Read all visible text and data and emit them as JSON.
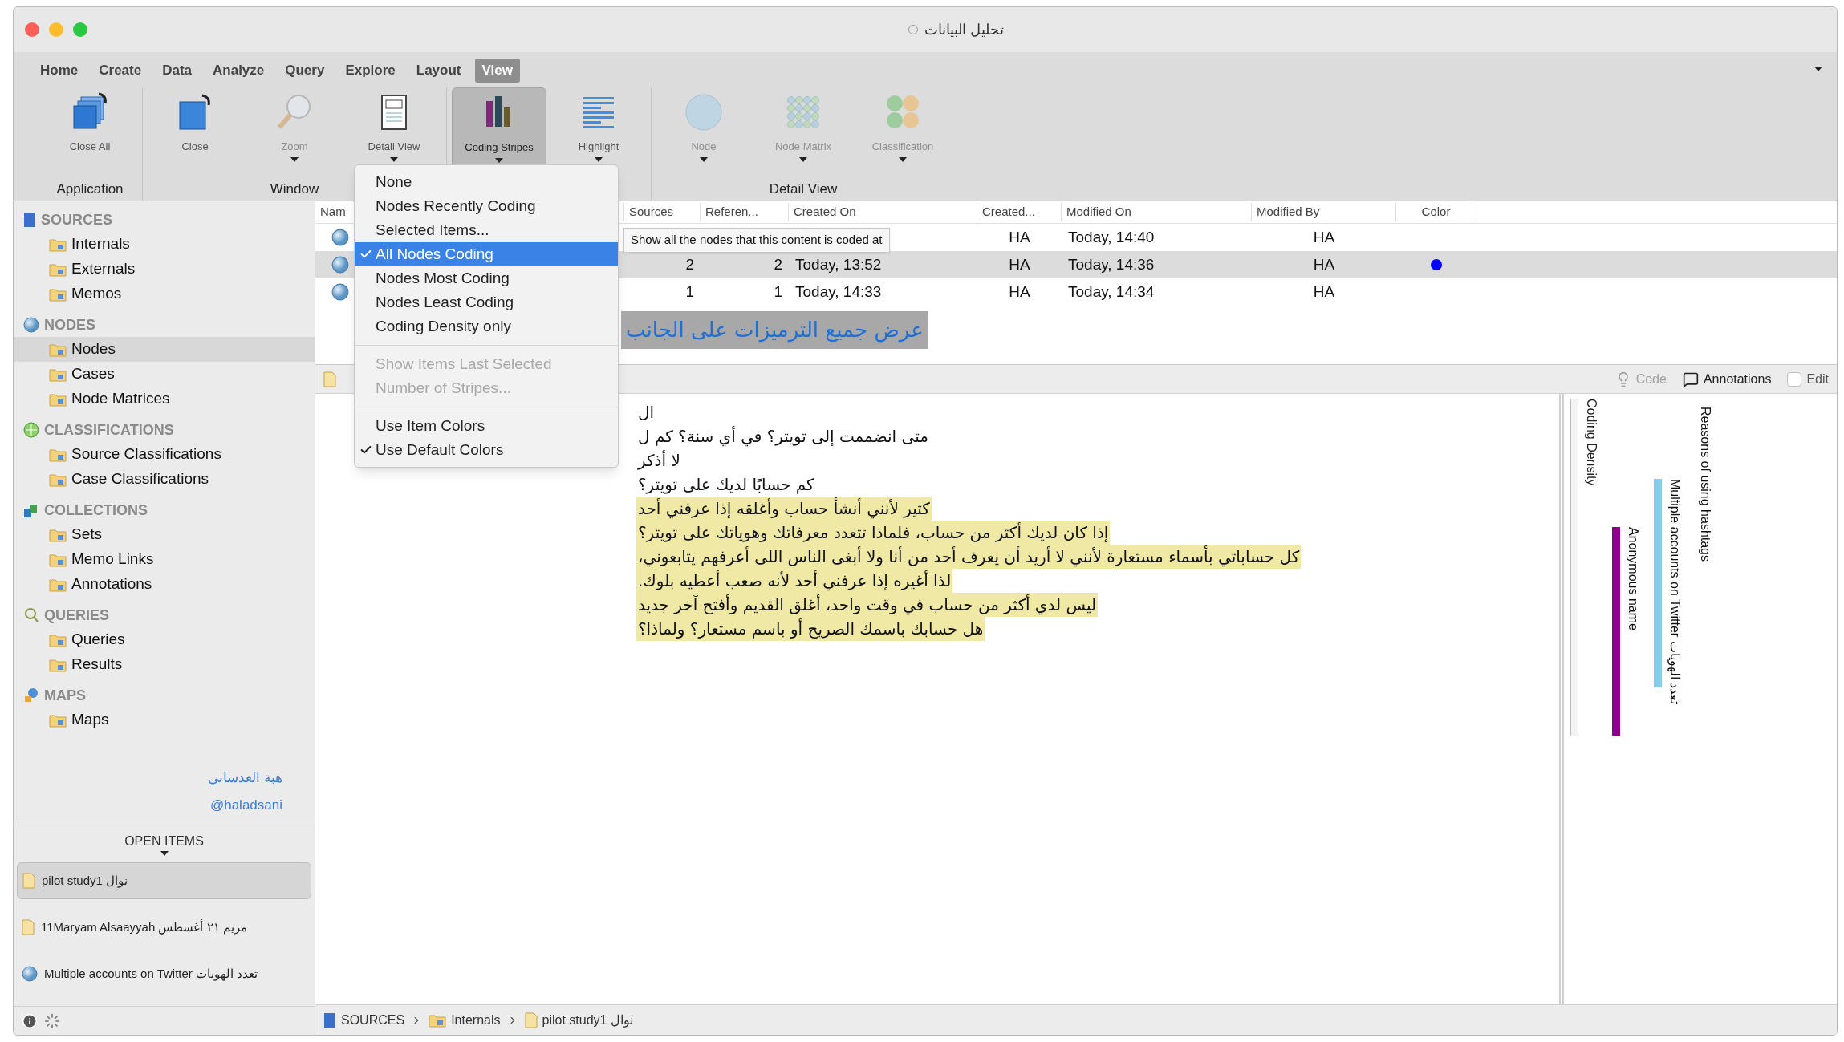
{
  "window": {
    "title": "تحليل البيانات"
  },
  "ribbon": {
    "tabs": [
      {
        "label": "Home",
        "selected": false
      },
      {
        "label": "Create",
        "selected": false
      },
      {
        "label": "Data",
        "selected": false
      },
      {
        "label": "Analyze",
        "selected": false
      },
      {
        "label": "Query",
        "selected": false
      },
      {
        "label": "Explore",
        "selected": false
      },
      {
        "label": "Layout",
        "selected": false
      },
      {
        "label": "View",
        "selected": true
      }
    ],
    "groups": [
      {
        "label": "Application",
        "buttons": [
          {
            "label": "Close All",
            "kind": "close-all",
            "disabled": false,
            "pressed": false,
            "dropdown": false
          }
        ]
      },
      {
        "label": "Window",
        "buttons": [
          {
            "label": "Close",
            "kind": "close",
            "disabled": false,
            "pressed": false,
            "dropdown": false
          },
          {
            "label": "Zoom",
            "kind": "zoom",
            "disabled": true,
            "pressed": false,
            "dropdown": true
          },
          {
            "label": "Detail View",
            "kind": "detail",
            "disabled": false,
            "pressed": false,
            "dropdown": true
          }
        ]
      },
      {
        "buttons": [
          {
            "label": "Coding Stripes",
            "kind": "stripes",
            "disabled": false,
            "pressed": true,
            "dropdown": true
          },
          {
            "label": "Highlight",
            "kind": "highlight",
            "disabled": false,
            "pressed": false,
            "dropdown": true
          }
        ]
      },
      {
        "label": "Detail View",
        "buttons": [
          {
            "label": "Node",
            "kind": "node",
            "disabled": true,
            "pressed": false,
            "dropdown": true
          },
          {
            "label": "Node Matrix",
            "kind": "matrix",
            "disabled": true,
            "pressed": false,
            "dropdown": true
          },
          {
            "label": "Classification",
            "kind": "classification",
            "disabled": true,
            "pressed": false,
            "dropdown": true
          }
        ]
      }
    ]
  },
  "sidebar": {
    "sections": [
      {
        "title": "SOURCES",
        "kind": "sources",
        "items": [
          {
            "label": "Internals",
            "selected": false
          },
          {
            "label": "Externals",
            "selected": false
          },
          {
            "label": "Memos",
            "selected": false
          }
        ]
      },
      {
        "title": "NODES",
        "kind": "nodes",
        "items": [
          {
            "label": "Nodes",
            "selected": true
          },
          {
            "label": "Cases",
            "selected": false
          },
          {
            "label": "Node Matrices",
            "selected": false
          }
        ]
      },
      {
        "title": "CLASSIFICATIONS",
        "kind": "classifications",
        "items": [
          {
            "label": "Source Classifications",
            "selected": false
          },
          {
            "label": "Case Classifications",
            "selected": false
          }
        ]
      },
      {
        "title": "COLLECTIONS",
        "kind": "collections",
        "items": [
          {
            "label": "Sets",
            "selected": false
          },
          {
            "label": "Memo Links",
            "selected": false
          },
          {
            "label": "Annotations",
            "selected": false
          }
        ]
      },
      {
        "title": "QUERIES",
        "kind": "queries",
        "items": [
          {
            "label": "Queries",
            "selected": false
          },
          {
            "label": "Results",
            "selected": false
          }
        ]
      },
      {
        "title": "MAPS",
        "kind": "maps",
        "items": [
          {
            "label": "Maps",
            "selected": false
          }
        ]
      }
    ],
    "signature": [
      "هبة العدساني",
      "@haladsani"
    ],
    "open_items": {
      "title": "OPEN ITEMS",
      "items": [
        {
          "label": "pilot study1 نوال",
          "kind": "document",
          "selected": true
        },
        {
          "label": "11Maryam Alsaayyah مريم ٢١ أغسطس",
          "kind": "document",
          "selected": false
        },
        {
          "label": "Multiple accounts on Twitter تعدد الهويات",
          "kind": "node",
          "selected": false
        }
      ]
    }
  },
  "table": {
    "columns": [
      "Nam",
      "Sources",
      "Referen...",
      "Created On",
      "Created...",
      "Modified On",
      "Modified By",
      "Color"
    ],
    "rows": [
      {
        "selected": false,
        "created_by": "HA",
        "modified_on": "Today, 14:40",
        "modified_by": "HA"
      },
      {
        "selected": true,
        "sources": "2",
        "references": "2",
        "created_on": "Today, 13:52",
        "created_by": "HA",
        "modified_on": "Today, 14:36",
        "modified_by": "HA",
        "color": "#0000ff"
      },
      {
        "selected": false,
        "sources": "1",
        "references": "1",
        "created_on": "Today, 14:33",
        "created_by": "HA",
        "modified_on": "Today, 14:34",
        "modified_by": "HA"
      }
    ]
  },
  "coding_stripes_menu": {
    "items": [
      {
        "kind": "item",
        "label": "None",
        "checked": false,
        "selected": false,
        "disabled": false
      },
      {
        "kind": "item",
        "label": "Nodes Recently Coding",
        "checked": false,
        "selected": false,
        "disabled": false
      },
      {
        "kind": "item",
        "label": "Selected Items...",
        "checked": false,
        "selected": false,
        "disabled": false
      },
      {
        "kind": "item",
        "label": "All Nodes Coding",
        "checked": true,
        "selected": true,
        "disabled": false
      },
      {
        "kind": "item",
        "label": "Nodes Most Coding",
        "checked": false,
        "selected": false,
        "disabled": false
      },
      {
        "kind": "item",
        "label": "Nodes Least Coding",
        "checked": false,
        "selected": false,
        "disabled": false
      },
      {
        "kind": "item",
        "label": "Coding Density only",
        "checked": false,
        "selected": false,
        "disabled": false
      },
      {
        "kind": "separator"
      },
      {
        "kind": "item",
        "label": "Show Items Last Selected",
        "checked": false,
        "selected": false,
        "disabled": true
      },
      {
        "kind": "item",
        "label": "Number of Stripes...",
        "checked": false,
        "selected": false,
        "disabled": true
      },
      {
        "kind": "separator"
      },
      {
        "kind": "item",
        "label": "Use Item Colors",
        "checked": false,
        "selected": false,
        "disabled": false
      },
      {
        "kind": "item",
        "label": "Use Default Colors",
        "checked": true,
        "selected": false,
        "disabled": false
      }
    ]
  },
  "tooltip": "Show all the nodes that this content is coded at",
  "annotation_label": "عرض جميع الترميزات على الجانب",
  "detail_toolbar": {
    "code": {
      "label": "Code",
      "disabled": true
    },
    "annotations": {
      "label": "Annotations"
    },
    "edit": {
      "label": "Edit",
      "checked": false
    }
  },
  "document": {
    "lines": [
      {
        "text": "ال",
        "highlighted": false
      },
      {
        "text": "متى انضممت إلى تويتر؟ في أي سنة؟ كم ل",
        "highlighted": false
      },
      {
        "text": "لا أذكر",
        "highlighted": false
      },
      {
        "text": "كم حسابًا لديك على تويتر؟",
        "highlighted": false
      },
      {
        "text": "كثير لأنني أنشأ حساب وأغلقه إذا عرفني أحد",
        "highlighted": true
      },
      {
        "text": "إذا كان لديك أكثر من حساب، فلماذا تتعدد معرفاتك وهوياتك على تويتر؟",
        "highlighted": true
      },
      {
        "text": "كل حساباتي بأسماء مستعارة لأنني لا أريد أن يعرف أحد من أنا ولا أبغى الناس اللى أعرفهم يتابعوني،",
        "highlighted": true
      },
      {
        "text": "لذا أغيره إذا عرفني أحد لأنه صعب أعطيه بلوك.",
        "highlighted": true
      },
      {
        "text": "ليس لدي أكثر من حساب في وقت واحد، أغلق القديم وأفتح آخر جديد",
        "highlighted": true
      },
      {
        "text": "هل حسابك باسمك الصريح أو باسم مستعار؟ ولماذا؟",
        "highlighted": true
      }
    ]
  },
  "stripes": {
    "density_label": "Coding Density",
    "items": [
      {
        "label": "Reasons of using hashtags"
      },
      {
        "label": "Multiple accounts on Twitter تعدد الهويات",
        "color": "#87ceeb"
      },
      {
        "label": "Anonymous name",
        "color": "#8b008b"
      }
    ]
  },
  "breadcrumb": [
    {
      "label": "SOURCES",
      "kind": "sources"
    },
    {
      "label": "Internals",
      "kind": "folder"
    },
    {
      "label": "pilot study1 نوال",
      "kind": "document"
    }
  ]
}
